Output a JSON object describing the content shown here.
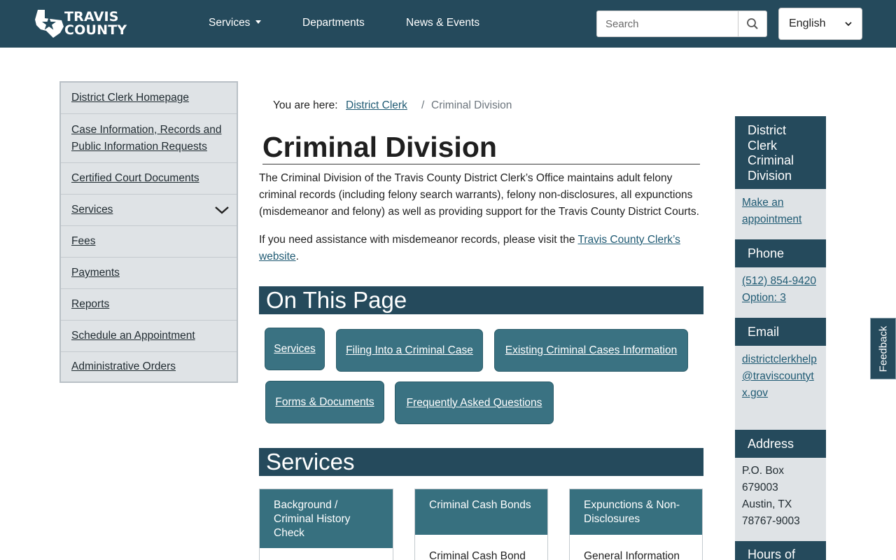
{
  "header": {
    "logo_line1": "TRAVIS",
    "logo_line2": "COUNTY",
    "nav": [
      "Services",
      "Departments",
      "News & Events"
    ],
    "search_placeholder": "Search",
    "language": "English",
    "bg_color": "#254a5c"
  },
  "sidebar": {
    "items": [
      {
        "label": "District Clerk Homepage"
      },
      {
        "label": "Case Information, Records and Public Information Requests"
      },
      {
        "label": "Certified Court Documents"
      },
      {
        "label": "Services"
      },
      {
        "label": "Fees"
      },
      {
        "label": "Payments"
      },
      {
        "label": "Reports"
      },
      {
        "label": "Schedule an Appointment"
      },
      {
        "label": "Administrative Orders"
      }
    ]
  },
  "breadcrumb": {
    "prefix": "You are here:",
    "parent": "District Clerk",
    "separator": "/",
    "current": "Criminal Division"
  },
  "main": {
    "title": "Criminal Division",
    "intro": "The Criminal Division of the Travis County District Clerk’s Office maintains adult felony criminal records (including felony search warrants), felony non-disclosures, all expunctions (misdemeanor and felony) as well as providing support for the Travis County District Courts.",
    "assist_text": "If you need assistance with misdemeanor records, please visit the ",
    "assist_link": "Travis County Clerk’s website",
    "assist_end": ".",
    "on_this_page": "On This Page",
    "chips": [
      "Services",
      "Filing Into a Criminal Case",
      "Existing Criminal Cases Information",
      "Forms & Documents",
      "Frequently Asked Questions"
    ],
    "services_heading": "Services",
    "cards": [
      {
        "title": "Background / Criminal History Check",
        "body": ""
      },
      {
        "title": "Criminal Cash Bonds",
        "body": "Criminal Cash Bond"
      },
      {
        "title": "Expunctions & Non-Disclosures",
        "body": "General Information"
      }
    ]
  },
  "right_panel": {
    "division_title": "District Clerk Criminal Division",
    "appointment_link": "Make an appointment",
    "phone_heading": "Phone",
    "phone": "(512) 854-9420",
    "phone_option": "Option: 3",
    "email_heading": "Email",
    "email": "districtclerkhelp@traviscountytx.gov",
    "address_heading": "Address",
    "address": [
      "P.O. Box",
      "679003",
      "Austin, TX",
      "78767-9003"
    ],
    "hours_heading": "Hours of"
  },
  "feedback_label": "Feedback"
}
